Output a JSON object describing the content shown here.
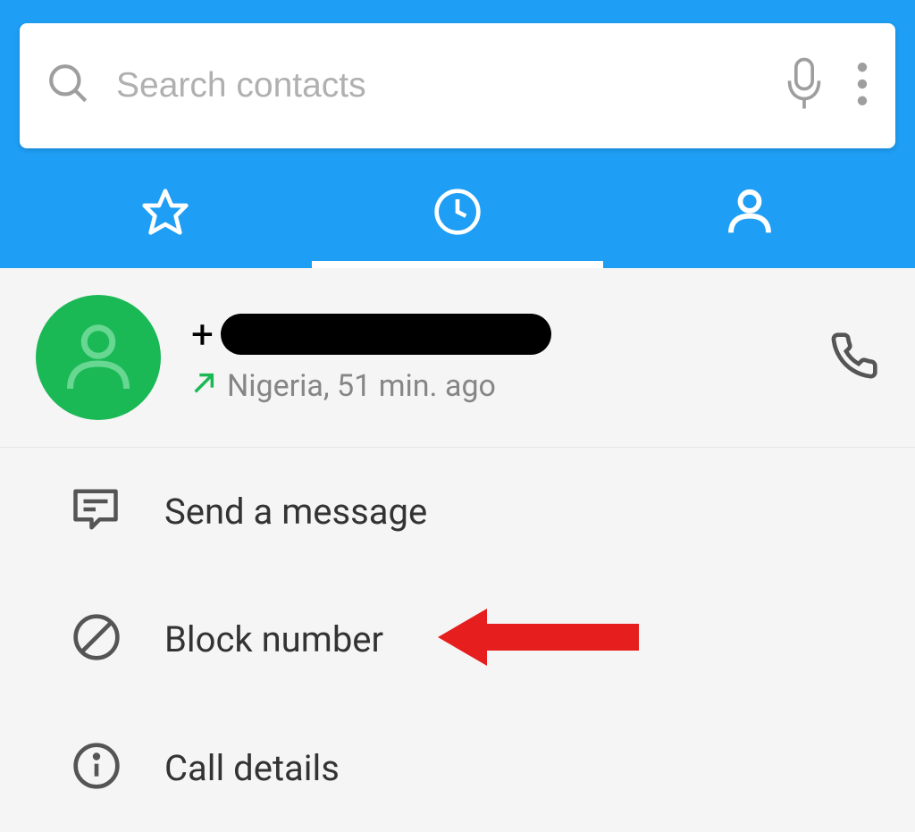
{
  "search": {
    "placeholder": "Search contacts"
  },
  "contact": {
    "number_prefix": "+",
    "location": "Nigeria, 51 min. ago"
  },
  "menu": {
    "send_message": "Send a message",
    "block_number": "Block number",
    "call_details": "Call details"
  }
}
